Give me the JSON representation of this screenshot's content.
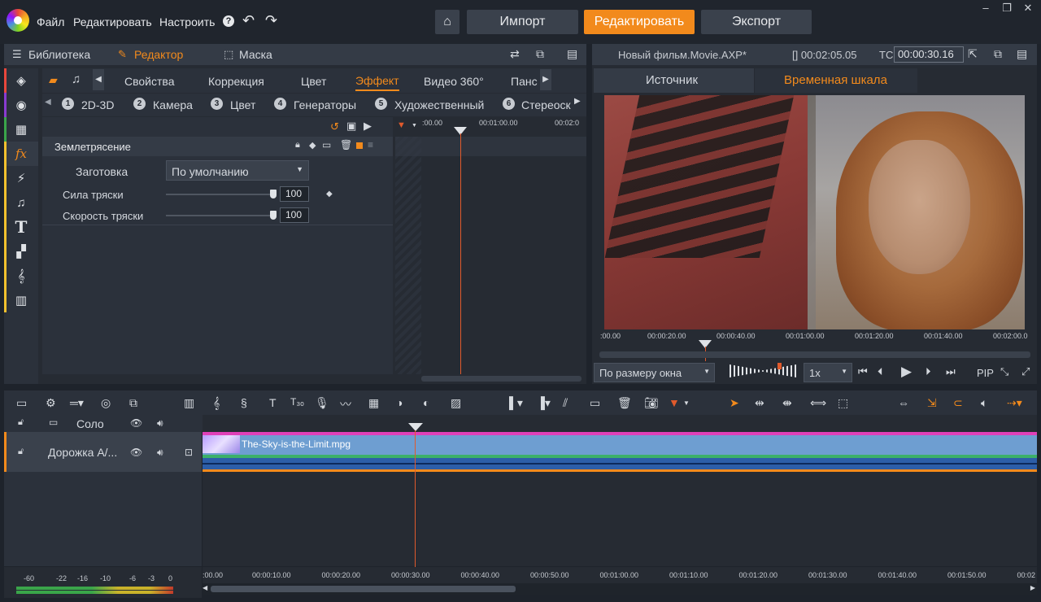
{
  "menu": {
    "file": "Файл",
    "edit": "Редактировать",
    "settings": "Настроить",
    "help": "?"
  },
  "modes": {
    "import": "Импорт",
    "edit": "Редактировать",
    "export": "Экспорт"
  },
  "left_tabs": {
    "library": "Библиотека",
    "editor": "Редактор",
    "mask": "Маска"
  },
  "effect_tabs": [
    "Свойства",
    "Коррекция",
    "Цвет",
    "Эффект",
    "Видео 360°",
    "Панс"
  ],
  "category_tabs": [
    {
      "num": "1",
      "label": "2D-3D"
    },
    {
      "num": "2",
      "label": "Камера"
    },
    {
      "num": "3",
      "label": "Цвет"
    },
    {
      "num": "4",
      "label": "Генераторы"
    },
    {
      "num": "5",
      "label": "Художественный"
    },
    {
      "num": "6",
      "label": "Стереоск"
    }
  ],
  "effect": {
    "name": "Землетрясение",
    "preset_label": "Заготовка",
    "preset_value": "По умолчанию",
    "param1_label": "Сила тряски",
    "param1_value": "100",
    "param2_label": "Скорость тряски",
    "param2_value": "100"
  },
  "kf_ruler": {
    "t0": ":00.00",
    "t1": "00:01:00.00",
    "t2": "00:02:0"
  },
  "preview": {
    "title": "Новый фильм.Movie.AXP*",
    "duration": "[] 00:02:05.05",
    "tc_label": "TC",
    "timecode": "00:00:30.16",
    "tab_source": "Источник",
    "tab_timeline": "Временная шкала",
    "ruler": [
      ":00.00",
      "00:00:20.00",
      "00:00:40.00",
      "00:01:00.00",
      "00:01:20.00",
      "00:01:40.00",
      "00:02:00.0"
    ],
    "zoom_select": "По размеру окна",
    "speed_select": "1x",
    "pip": "PIP"
  },
  "tracks": {
    "header_label": "Соло",
    "track_name": "Дорожка А/...",
    "clip_name": "The-Sky-is-the-Limit.mpg"
  },
  "timeline_ruler": [
    ":00.00",
    "00:00:10.00",
    "00:00:20.00",
    "00:00:30.00",
    "00:00:40.00",
    "00:00:50.00",
    "00:01:00.00",
    "00:01:10.00",
    "00:01:20.00",
    "00:01:30.00",
    "00:01:40.00",
    "00:01:50.00",
    "00:02"
  ],
  "meter_labels": [
    "-60",
    "-22",
    "-16",
    "-10",
    "-6",
    "-3",
    "0"
  ],
  "colors": {
    "accent": "#f28a1c",
    "clip": "#6e9ed1",
    "clip_top": "#e040b8",
    "playhead": "#e05a2c"
  }
}
